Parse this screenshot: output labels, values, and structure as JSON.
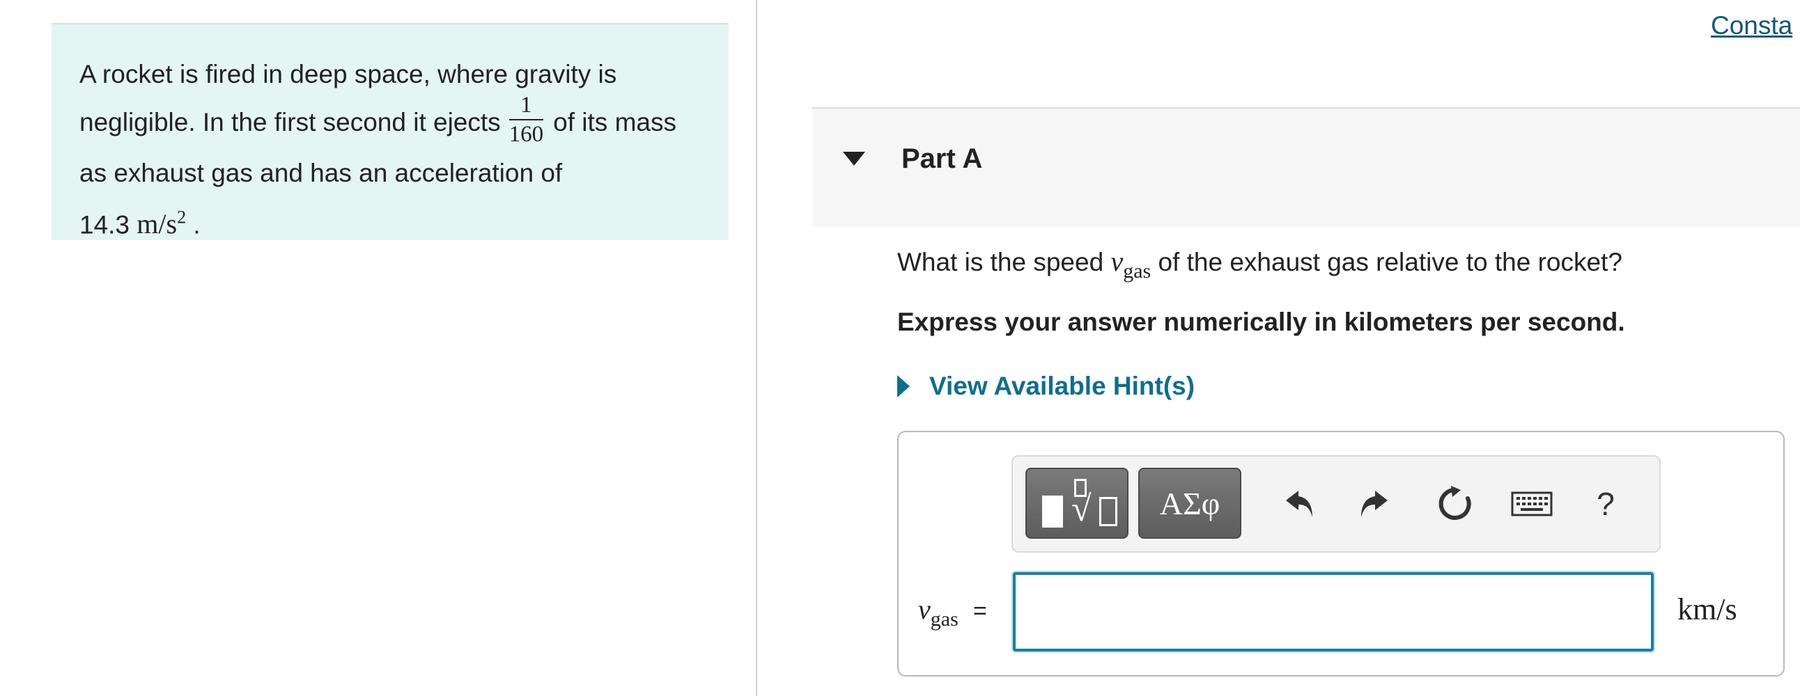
{
  "problem": {
    "text_before": "A rocket is fired in deep space, where gravity is negligible. In the first second it ejects",
    "fraction_num": "1",
    "fraction_den": "160",
    "text_middle": "of its mass as exhaust gas and has an acceleration of",
    "value": "14.3",
    "unit": "m/s",
    "unit_exp": "2",
    "text_end": "."
  },
  "constants_link": "Consta",
  "part": {
    "title": "Part A"
  },
  "question": {
    "before": "What is the speed",
    "var": "v",
    "var_sub": "gas",
    "after": "of the exhaust gas relative to the rocket?"
  },
  "instruction": "Express your answer numerically in kilometers per second.",
  "hints_label": "View Available Hint(s)",
  "toolbar": {
    "greek_label": "ΑΣφ",
    "help_label": "?",
    "icons": [
      "templates-icon",
      "greek-symbols-icon",
      "undo-icon",
      "redo-icon",
      "reset-icon",
      "keyboard-icon",
      "help-icon"
    ]
  },
  "answer": {
    "var": "v",
    "var_sub": "gas",
    "equals": "=",
    "value": "",
    "units": "km/s"
  },
  "colors": {
    "problem_bg": "#e4f5f4",
    "link": "#14577a",
    "hint": "#0e6e8f",
    "input_border": "#1a7fa2"
  }
}
